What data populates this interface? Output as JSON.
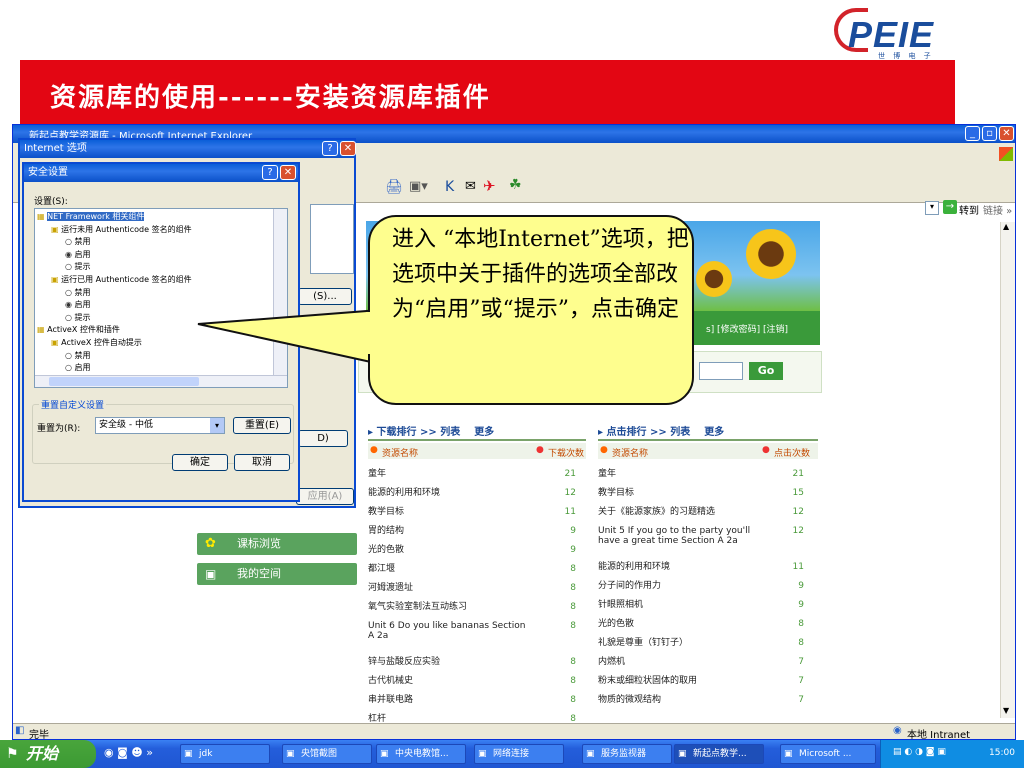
{
  "logo": {
    "text": "PEIE",
    "sub": "世 博 电 子"
  },
  "slide_title": "资源库的使用------安装资源库插件",
  "ie": {
    "title": "新起点教学资源库 - Microsoft Internet Explorer",
    "go_label": "转到",
    "links_label": "链接 »",
    "status_text": "完毕",
    "zone": "本地 Intranet"
  },
  "page": {
    "user_links": "s] [修改密码] [注销]",
    "go_button": "Go",
    "side_buttons": [
      "课标浏览",
      "我的空间"
    ],
    "download_rank": {
      "header": "下载排行 >> 列表",
      "more": "更多",
      "col_name": "资源名称",
      "col_count": "下载次数",
      "rows": [
        [
          "童年",
          "21"
        ],
        [
          "能源的利用和环境",
          "12"
        ],
        [
          "教学目标",
          "11"
        ],
        [
          "胃的结构",
          "9"
        ],
        [
          "光的色散",
          "9"
        ],
        [
          "都江堰",
          "8"
        ],
        [
          "河姆渡遗址",
          "8"
        ],
        [
          "氧气实验室制法互动练习",
          "8"
        ],
        [
          "Unit 6 Do you like bananas Section A 2a",
          "8"
        ],
        [
          "锌与盐酸反应实验",
          "8"
        ],
        [
          "古代机械史",
          "8"
        ],
        [
          "串并联电路",
          "8"
        ],
        [
          "杠杆",
          "8"
        ]
      ]
    },
    "click_rank": {
      "header": "点击排行 >> 列表",
      "more": "更多",
      "col_name": "资源名称",
      "col_count": "点击次数",
      "rows": [
        [
          "童年",
          "21"
        ],
        [
          "教学目标",
          "15"
        ],
        [
          "关于《能源家族》的习题精选",
          "12"
        ],
        [
          "Unit 5 If you go to the party you'll have a great time Section A 2a",
          "12"
        ],
        [
          "能源的利用和环境",
          "11"
        ],
        [
          "分子间的作用力",
          "9"
        ],
        [
          "针眼照相机",
          "9"
        ],
        [
          "光的色散",
          "8"
        ],
        [
          "礼貌是尊重（钉钉子）",
          "8"
        ],
        [
          "内燃机",
          "7"
        ],
        [
          "粉末或细粒状固体的取用",
          "7"
        ],
        [
          "物质的微观结构",
          "7"
        ]
      ]
    }
  },
  "inet_options": {
    "title": "Internet 选项",
    "btn_s": "(S)...",
    "btn_d": "D)",
    "apply": "应用(A)"
  },
  "security": {
    "title": "安全设置",
    "settings_label": "设置(S):",
    "tree": [
      "NET Framework 相关组件",
      "运行未用 Authenticode 签名的组件",
      "禁用",
      "启用",
      "提示",
      "运行已用 Authenticode 签名的组件",
      "禁用",
      "启用",
      "提示",
      "ActiveX 控件和插件",
      "ActiveX 控件自动提示",
      "禁用",
      "启用"
    ],
    "reset_group": "重置自定义设置",
    "reset_to": "重置为(R):",
    "reset_value": "安全级 - 中低",
    "reset_button": "重置(E)",
    "ok": "确定",
    "cancel": "取消"
  },
  "callout": "进入 “本地Internet”选项，把选项中关于插件的选项全部改为“启用”或“提示”，点击确定",
  "taskbar": {
    "start": "开始",
    "tasks": [
      "jdk",
      "央馆截图",
      "中央电教馆...",
      "网络连接",
      "服务监视器",
      "新起点教学...",
      "Microsoft ..."
    ],
    "time": "15:00"
  }
}
